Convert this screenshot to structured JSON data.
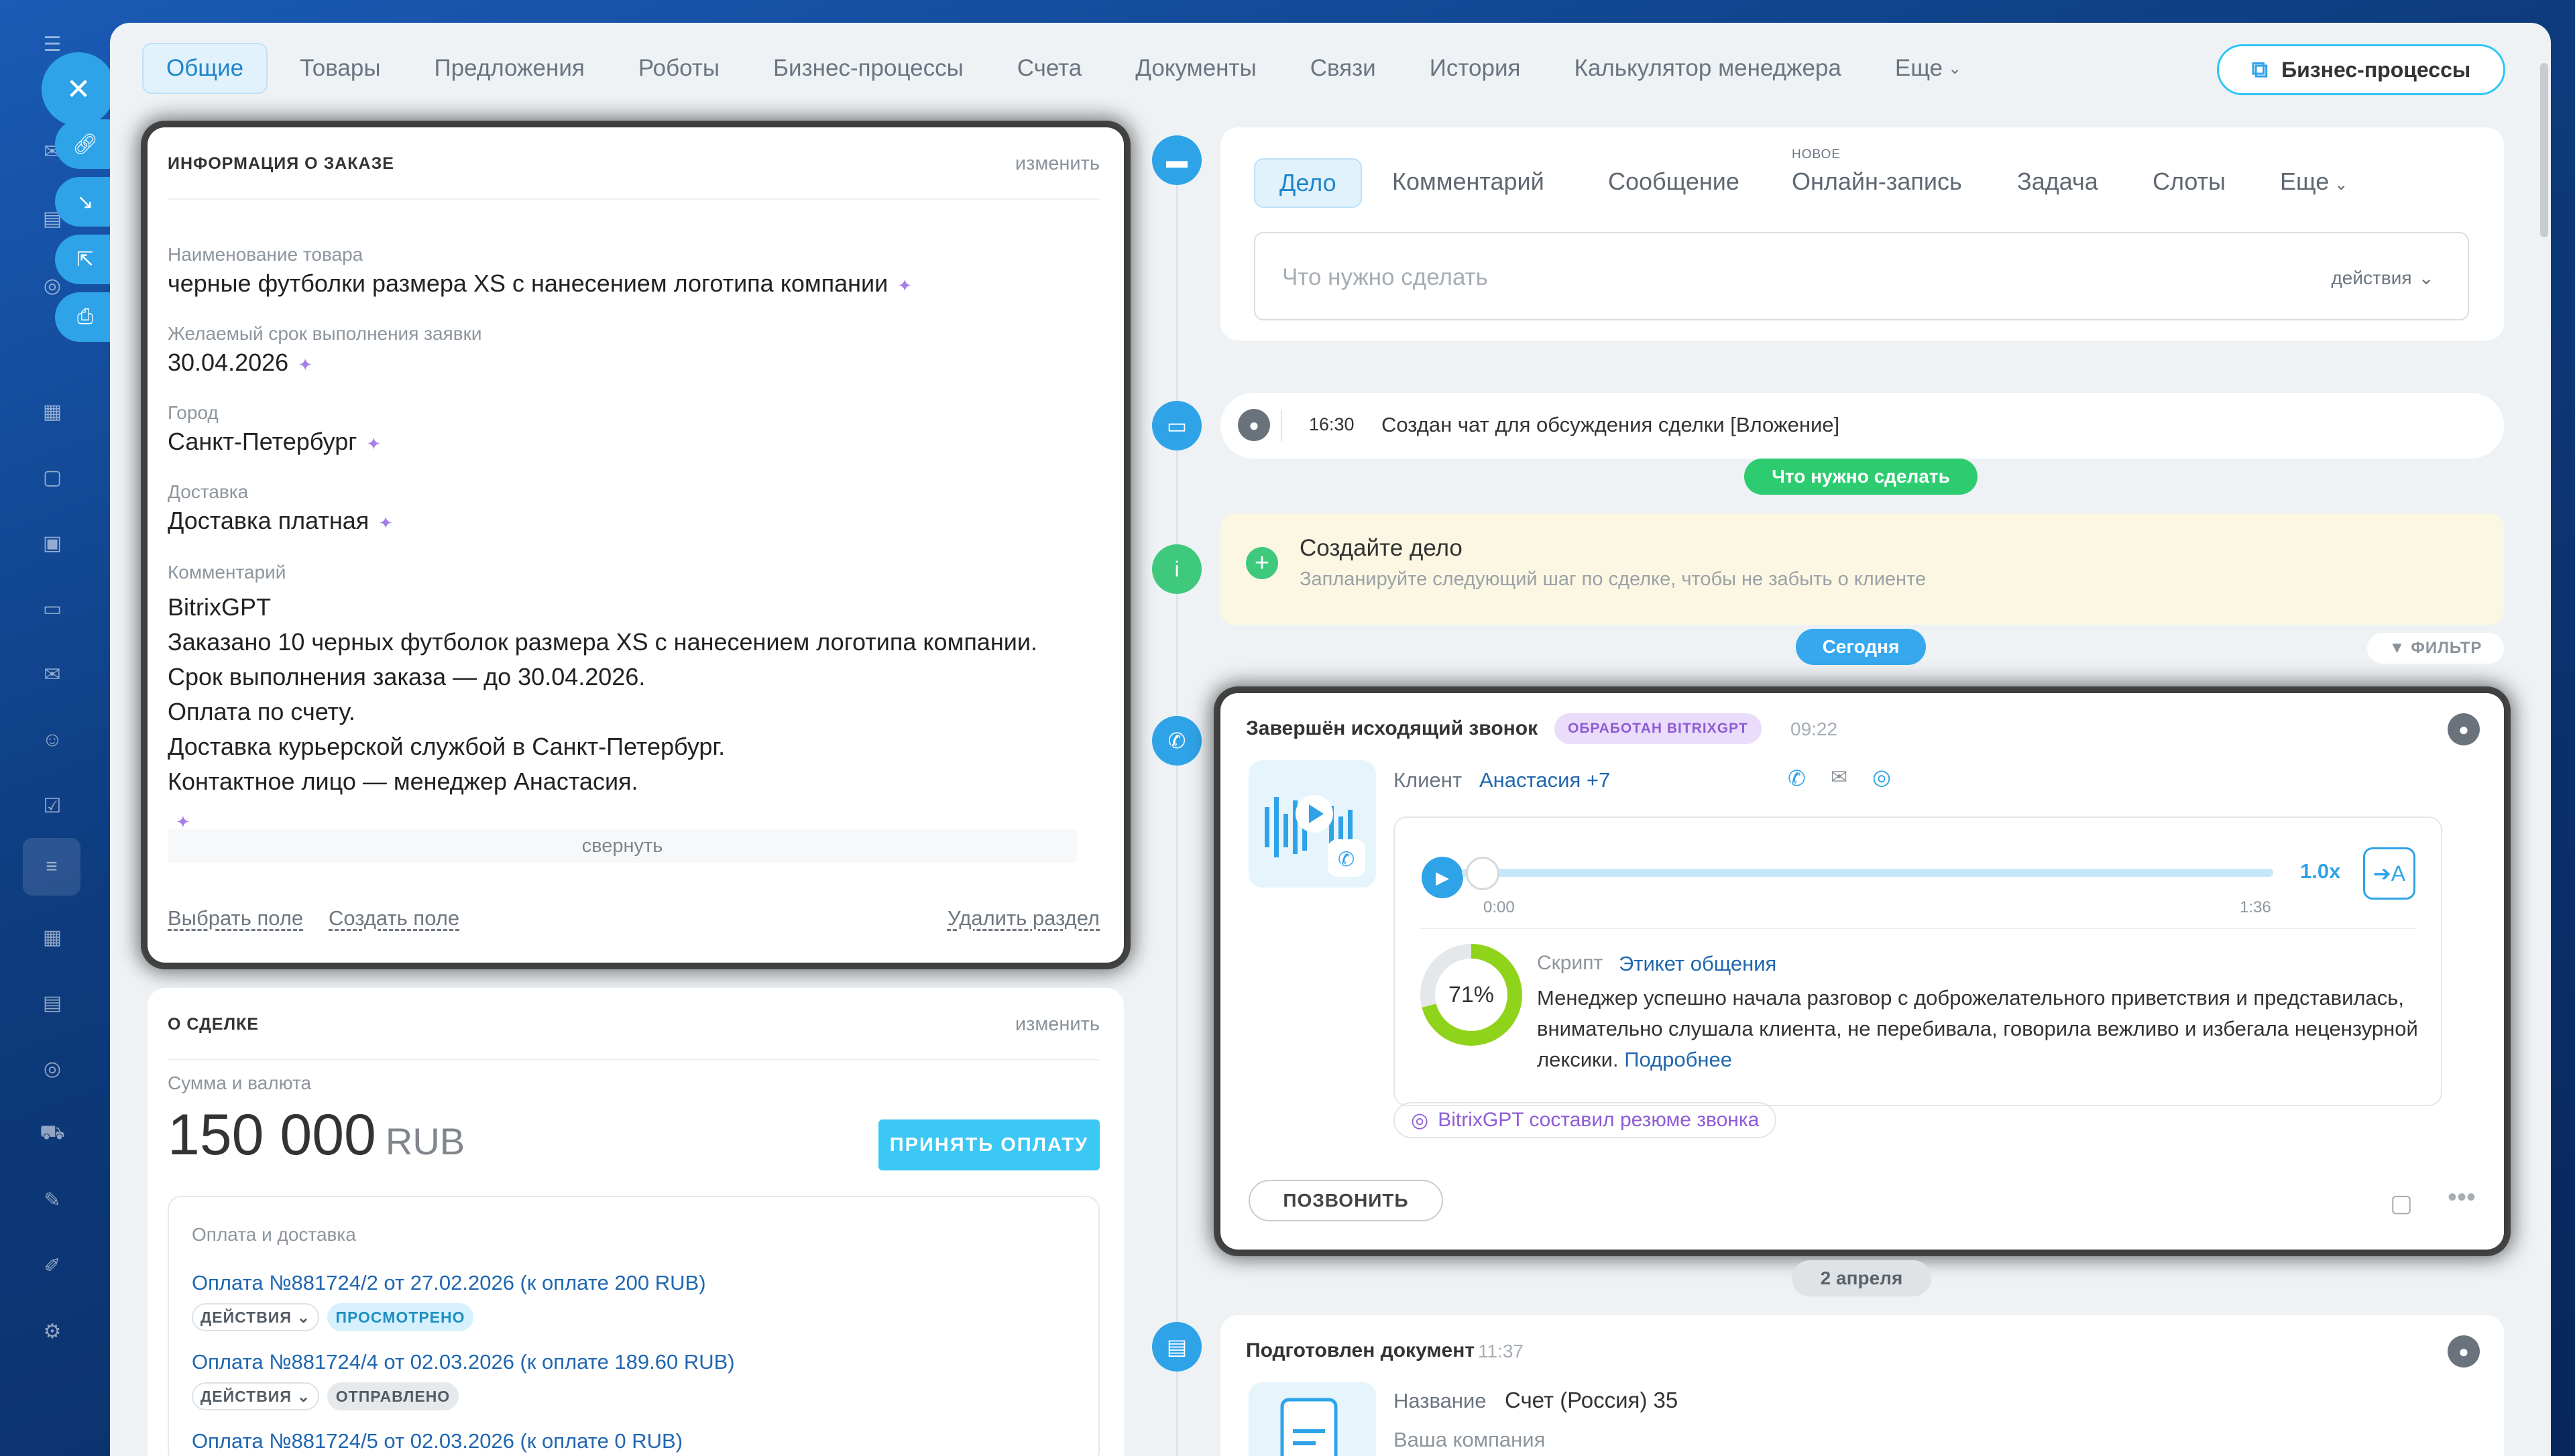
{
  "nav": {
    "tabs": [
      "Общие",
      "Товары",
      "Предложения",
      "Роботы",
      "Бизнес-процессы",
      "Счета",
      "Документы",
      "Связи",
      "История",
      "Калькулятор менеджера",
      "Еще"
    ],
    "bp_button": "Бизнес-процессы"
  },
  "order_info": {
    "title": "ИНФОРМАЦИЯ О ЗАКАЗЕ",
    "edit": "изменить",
    "fields": [
      {
        "label": "Наименование товара",
        "value": "черные футболки размера XS с нанесением логотипа компании"
      },
      {
        "label": "Желаемый срок выполнения заявки",
        "value": "30.04.2026"
      },
      {
        "label": "Город",
        "value": "Санкт-Петербург"
      },
      {
        "label": "Доставка",
        "value": "Доставка платная"
      }
    ],
    "comment_label": "Комментарий",
    "comment_lines": [
      "BitrixGPT",
      "Заказано 10 черных футболок размера XS с нанесением логотипа компании.",
      "Срок выполнения заказа — до 30.04.2026.",
      "Оплата по счету.",
      "Доставка курьерской службой в Санкт-Петербург.",
      "Контактное лицо — менеджер Анастасия."
    ],
    "collapse": "свернуть",
    "select_field": "Выбрать поле",
    "create_field": "Создать поле",
    "delete_section": "Удалить раздел"
  },
  "deal": {
    "title": "О СДЕЛКЕ",
    "edit": "изменить",
    "sum_label": "Сумма и валюта",
    "sum": "150 000",
    "currency": "RUB",
    "pay_button": "ПРИНЯТЬ ОПЛАТУ",
    "payments_title": "Оплата и доставка",
    "payments": [
      {
        "link": "Оплата №881724/2 от 27.02.2026 (к оплате 200 RUB)",
        "action": "ДЕЙСТВИЯ",
        "status": "ПРОСМОТРЕНО"
      },
      {
        "link": "Оплата №881724/4 от 02.03.2026 (к оплате 189.60 RUB)",
        "action": "ДЕЙСТВИЯ",
        "status": "ОТПРАВЛЕНО"
      },
      {
        "link": "Оплата №881724/5 от 02.03.2026 (к оплате 0 RUB)"
      }
    ]
  },
  "editor": {
    "tabs": [
      "Дело",
      "Комментарий",
      "Сообщение",
      "Онлайн-запись",
      "Задача",
      "Слоты",
      "Еще"
    ],
    "new_tag": "НОВОЕ",
    "placeholder": "Что нужно сделать",
    "actions": "действия"
  },
  "timeline": {
    "chat_time": "16:30",
    "chat_text": "Создан чат для обсуждения сделки [Вложение]",
    "todo_badge": "Что нужно сделать",
    "create_title": "Создайте дело",
    "create_sub": "Запланируйте следующий шаг по сделке, чтобы не забыть о клиенте",
    "today_badge": "Сегодня",
    "filter": "ФИЛЬТР",
    "call": {
      "title": "Завершён исходящий звонок",
      "badge": "ОБРАБОТАН BITRIXGPT",
      "time": "09:22",
      "client_label": "Клиент",
      "client_name": "Анастасия +7",
      "speed": "1.0x",
      "start": "0:00",
      "end": "1:36",
      "percent": "71%",
      "percent_value": 0.71,
      "script_label": "Скрипт",
      "script_name": "Этикет общения",
      "summary": "Менеджер успешно начала разговор с доброжелательного приветствия и представилась, внимательно слушала клиента, не перебивала, говорила вежливо и избегала нецензурной лексики.",
      "more": "Подробнее",
      "gpt_pill": "BitrixGPT составил резюме звонка",
      "call_button": "ПОЗВОНИТЬ"
    },
    "date_badge": "2 апреля",
    "doc": {
      "title": "Подготовлен документ",
      "time": "11:37",
      "name_label": "Название",
      "name": "Счет (Россия) 35",
      "company_label": "Ваша компания"
    }
  },
  "colors": {
    "accent": "#2fa3e8",
    "green": "#2ecc71",
    "link": "#2067b0",
    "gpt": "#8e5bd6"
  }
}
